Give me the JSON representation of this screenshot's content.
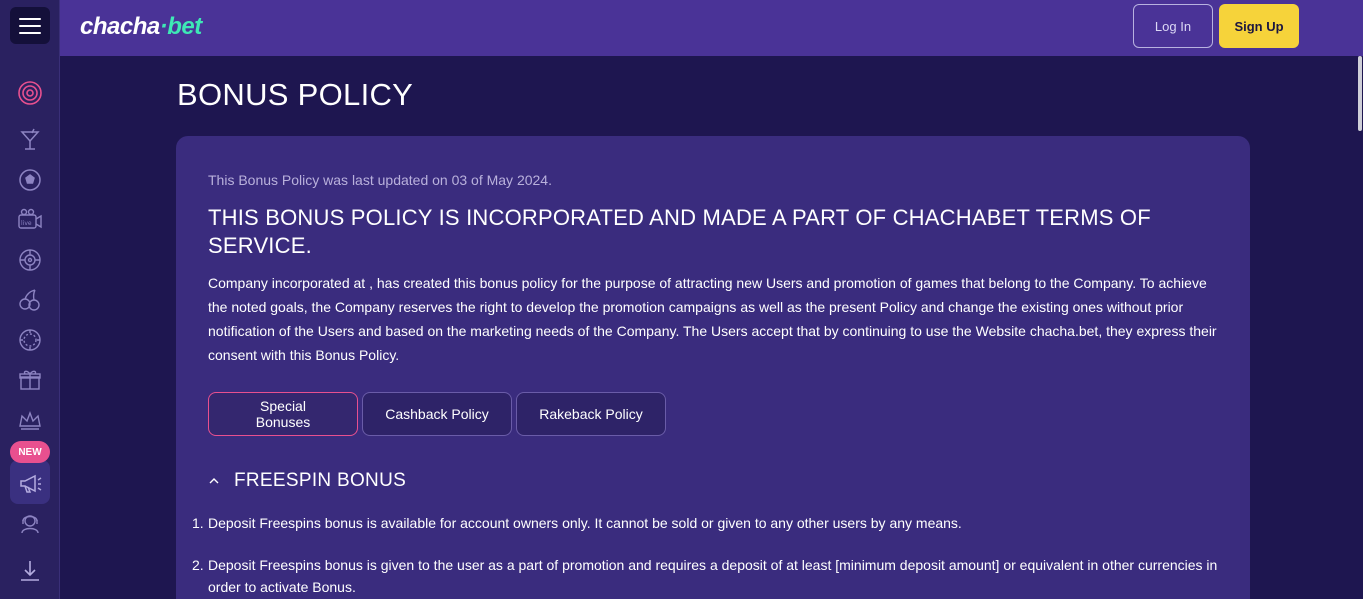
{
  "header": {
    "logo_left": "chacha",
    "logo_dot": "·",
    "logo_right": "bet",
    "login_label": "Log In",
    "signup_label": "Sign Up"
  },
  "sidebar": {
    "new_badge": "NEW",
    "items": [
      {
        "icon": "target-icon"
      },
      {
        "icon": "cocktail-icon"
      },
      {
        "icon": "soccer-ball-icon"
      },
      {
        "icon": "live-camera-icon"
      },
      {
        "icon": "roulette-icon"
      },
      {
        "icon": "cherries-icon"
      },
      {
        "icon": "poker-chip-icon"
      },
      {
        "icon": "gift-icon"
      },
      {
        "icon": "crown-icon"
      },
      {
        "icon": "megaphone-icon"
      },
      {
        "icon": "support-agent-icon"
      },
      {
        "icon": "download-icon"
      }
    ]
  },
  "page": {
    "title": "BONUS POLICY",
    "updated": "This Bonus Policy was last updated on 03 of May 2024.",
    "heading": "THIS BONUS POLICY IS INCORPORATED AND MADE A PART OF CHACHABET TERMS OF SERVICE.",
    "intro": "Company incorporated at , has created this bonus policy for the purpose of attracting new Users and promotion of games that belong to the Company. To achieve the noted goals, the Company reserves the right to develop the promotion campaigns as well as the present Policy and change the existing ones without prior notification of the Users and based on the marketing needs of the Company. The Users accept that by continuing to use the Website chacha.bet, they express their consent with this Bonus Policy.",
    "tabs": [
      {
        "label": "Special Bonuses",
        "active": true
      },
      {
        "label": "Cashback Policy",
        "active": false
      },
      {
        "label": "Rakeback Policy",
        "active": false
      }
    ],
    "section_title": "FREESPIN BONUS",
    "rules": [
      {
        "num": "1.",
        "text": "Deposit Freespins bonus is available for account owners only. It cannot be sold or given to any other users by any means."
      },
      {
        "num": "2.",
        "text": "Deposit Freespins bonus is given to the user as a part of promotion and requires a deposit of at least [minimum deposit amount] or equivalent in other currencies in order to activate Bonus."
      }
    ]
  },
  "colors": {
    "background": "#1e1650",
    "header": "#4a3397",
    "card": "#3a2c7e",
    "accent_pink": "#e8508f",
    "accent_yellow": "#f6d33a",
    "logo_green": "#3ee8b5"
  }
}
